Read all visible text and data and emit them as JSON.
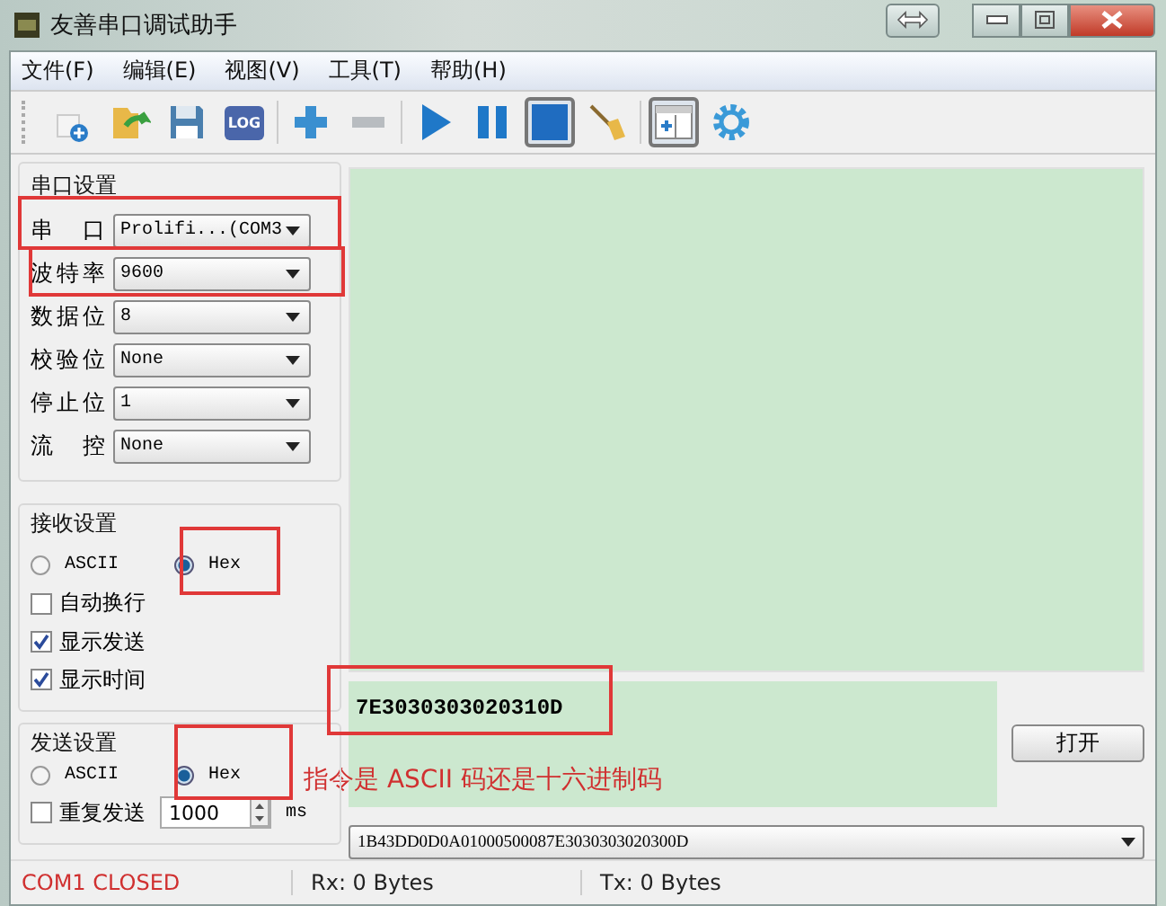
{
  "window": {
    "title": "友善串口调试助手"
  },
  "menu": [
    {
      "label": "文件(F)"
    },
    {
      "label": "编辑(E)"
    },
    {
      "label": "视图(V)"
    },
    {
      "label": "工具(T)"
    },
    {
      "label": "帮助(H)"
    }
  ],
  "toolbar": [
    {
      "kind": "new",
      "pressed": false
    },
    {
      "kind": "open",
      "pressed": false
    },
    {
      "kind": "save",
      "pressed": false
    },
    {
      "kind": "log",
      "label": "LOG",
      "pressed": false
    },
    {
      "kind": "sep"
    },
    {
      "kind": "add",
      "pressed": false
    },
    {
      "kind": "remove",
      "pressed": false
    },
    {
      "kind": "sep"
    },
    {
      "kind": "play",
      "pressed": false
    },
    {
      "kind": "pause",
      "pressed": false
    },
    {
      "kind": "square",
      "pressed": true
    },
    {
      "kind": "broom",
      "pressed": false
    },
    {
      "kind": "sep"
    },
    {
      "kind": "panel",
      "pressed": true
    },
    {
      "kind": "gear",
      "pressed": false
    }
  ],
  "serial_settings": {
    "title": "串口设置",
    "fields": [
      {
        "label": "串 口",
        "value": "Prolifi...(COM3"
      },
      {
        "label": "波特率",
        "value": "9600"
      },
      {
        "label": "数据位",
        "value": "8"
      },
      {
        "label": "校验位",
        "value": "None"
      },
      {
        "label": "停止位",
        "value": "1"
      },
      {
        "label": "流 控",
        "value": "None"
      }
    ]
  },
  "receive_settings": {
    "title": "接收设置",
    "modes": [
      {
        "label": "ASCII",
        "selected": false
      },
      {
        "label": "Hex",
        "selected": true
      }
    ],
    "options": [
      {
        "label": "自动换行",
        "checked": false
      },
      {
        "label": "显示发送",
        "checked": true
      },
      {
        "label": "显示时间",
        "checked": true
      }
    ]
  },
  "send_settings": {
    "title": "发送设置",
    "modes": [
      {
        "label": "ASCII",
        "selected": false
      },
      {
        "label": "Hex",
        "selected": true
      }
    ],
    "repeat": {
      "label": "重复发送",
      "checked": false,
      "value": "1000",
      "unit": "ms"
    }
  },
  "send_text": "7E3030303020310D",
  "open_button": "打开",
  "annotation": "指令是 ASCII 码还是十六进制码",
  "history_value": "1B43DD0D0A01000500087E3030303020300D",
  "status_bar": [
    {
      "text": "COM1 CLOSED",
      "kind": "error"
    },
    {
      "text": "Rx: 0 Bytes",
      "kind": "normal"
    },
    {
      "text": "Tx: 0 Bytes",
      "kind": "normal"
    }
  ]
}
